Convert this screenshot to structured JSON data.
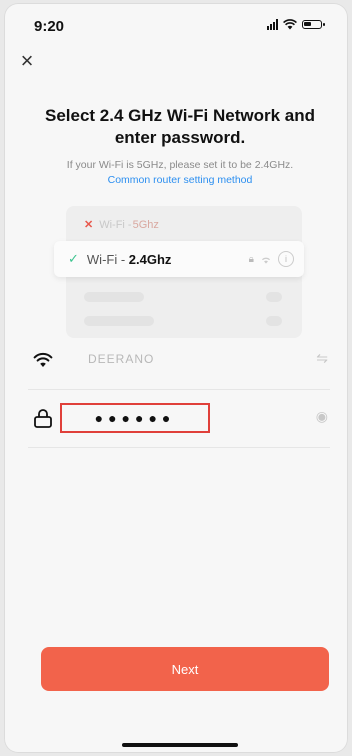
{
  "status_bar": {
    "time": "9:20"
  },
  "header": {
    "title": "Select 2.4 GHz Wi-Fi Network and enter password."
  },
  "subtitle": "If your Wi-Fi is 5GHz, please set it to be 2.4GHz.",
  "link_text": "Common router setting method",
  "illustration": {
    "bad_prefix": "Wi-Fi - ",
    "bad_band": "5Ghz",
    "good_prefix": "Wi-Fi - ",
    "good_band": "2.4Ghz"
  },
  "form": {
    "wifi_name": "DEERANO",
    "password_masked": "●●●●●●"
  },
  "next_label": "Next",
  "colors": {
    "accent": "#f2634b",
    "link": "#2c8ff0",
    "check": "#3cc48f",
    "error": "#e8584c",
    "highlight_box": "#e0403a"
  },
  "icons": [
    "close-icon",
    "wifi-icon",
    "lock-icon",
    "swap-icon",
    "eye-icon",
    "check-icon",
    "info-icon"
  ]
}
